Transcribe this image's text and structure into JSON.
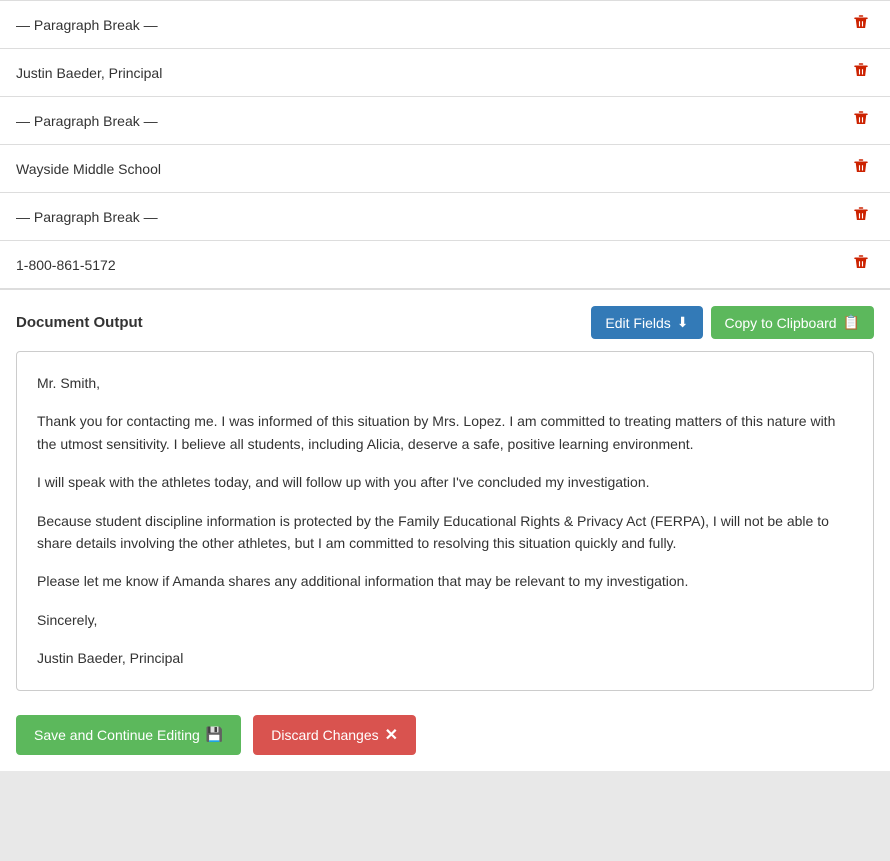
{
  "list_items": [
    {
      "id": 1,
      "text": "— Paragraph Break —"
    },
    {
      "id": 2,
      "text": "Justin Baeder, Principal"
    },
    {
      "id": 3,
      "text": "— Paragraph Break —"
    },
    {
      "id": 4,
      "text": "Wayside Middle School"
    },
    {
      "id": 5,
      "text": "— Paragraph Break —"
    },
    {
      "id": 6,
      "text": "1-800-861-5172"
    }
  ],
  "document_output": {
    "label": "Document Output",
    "edit_fields_btn": "Edit Fields",
    "copy_clipboard_btn": "Copy to Clipboard",
    "paragraphs": [
      "Mr. Smith,",
      "Thank you for contacting me. I was informed of this situation by Mrs. Lopez. I am committed to treating matters of this nature with the utmost sensitivity. I believe all students, including Alicia, deserve a safe, positive learning environment.",
      "I will speak with the athletes today, and will follow up with you after I've concluded my investigation.",
      "Because student discipline information is protected by the Family Educational Rights & Privacy Act (FERPA), I will not be able to share details involving the other athletes, but I am committed to resolving this situation quickly and fully.",
      "Please let me know if Amanda shares any additional information that may be relevant to my investigation.",
      "Sincerely,",
      "Justin Baeder, Principal"
    ]
  },
  "actions": {
    "save_label": "Save and Continue Editing",
    "discard_label": "Discard Changes"
  },
  "icons": {
    "trash": "🗑",
    "edit": "⬇",
    "clipboard": "📋",
    "save": "💾",
    "close": "✕"
  }
}
